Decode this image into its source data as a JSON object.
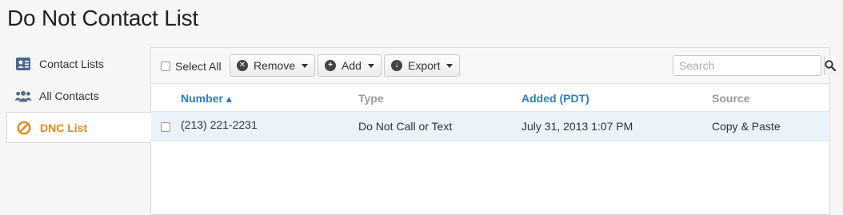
{
  "page": {
    "title": "Do Not Contact List"
  },
  "sidebar": {
    "items": [
      {
        "label": "Contact Lists",
        "icon": "contact-card-icon",
        "active": false
      },
      {
        "label": "All Contacts",
        "icon": "people-group-icon",
        "active": false
      },
      {
        "label": "DNC List",
        "icon": "prohibited-icon",
        "active": true
      }
    ]
  },
  "toolbar": {
    "select_all_label": "Select All",
    "remove_label": "Remove",
    "add_label": "Add",
    "export_label": "Export",
    "search_placeholder": "Search"
  },
  "table": {
    "columns": [
      {
        "label": "Number ▴",
        "sortable": true,
        "sorted": "asc"
      },
      {
        "label": "Type",
        "sortable": false
      },
      {
        "label": "Added (PDT)",
        "sortable": true
      },
      {
        "label": "Source",
        "sortable": false
      }
    ],
    "rows": [
      {
        "number": "(213) 221-2231",
        "type": "Do Not Call or Text",
        "added": "July 31, 2013 1:07 PM",
        "source": "Copy & Paste"
      }
    ]
  },
  "colors": {
    "accent": "#e8871e",
    "link": "#2a7ccc",
    "row_highlight": "#eaf2fa"
  }
}
